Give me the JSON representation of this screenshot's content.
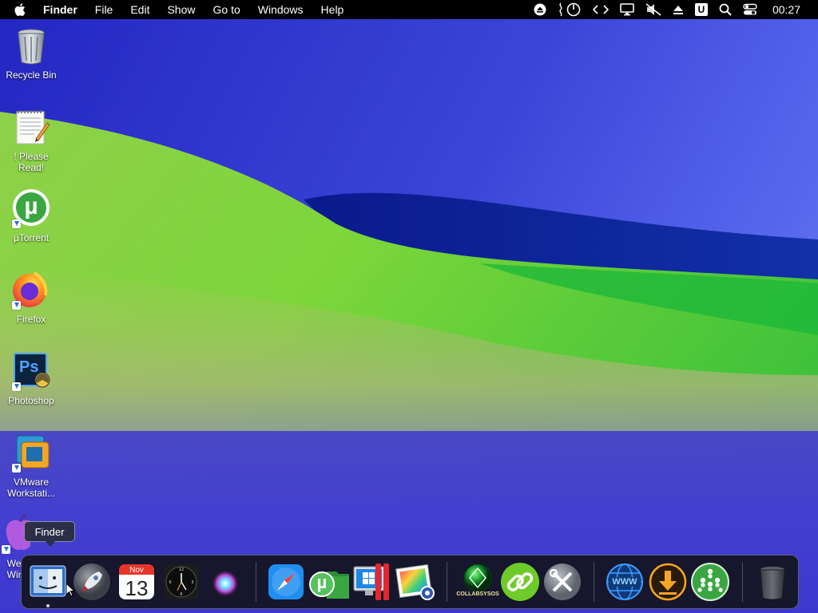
{
  "menubar": {
    "app_name": "Finder",
    "items": [
      "File",
      "Edit",
      "Show",
      "Go to",
      "Windows",
      "Help"
    ],
    "status_icons": [
      "eject-icon",
      "power-gauge-icon",
      "code-brackets-icon",
      "display-icon",
      "mute-icon",
      "up-triangle-icon",
      "u-badge-icon",
      "search-icon",
      "control-center-icon"
    ],
    "u_badge_label": "U",
    "clock": "00:27"
  },
  "desktop": {
    "icons": [
      {
        "label": "Recycle Bin"
      },
      {
        "label": "! Please Read!"
      },
      {
        "label": "μTorrent"
      },
      {
        "label": "Firefox"
      },
      {
        "label": "Photoshop"
      },
      {
        "label": "VMware Workstati..."
      },
      {
        "label": "Wel Win"
      }
    ]
  },
  "tooltip": {
    "label": "Finder"
  },
  "dock": {
    "calendar": {
      "month": "Nov",
      "day": "13"
    },
    "collabsysos_label": "COLLABSYSOS",
    "www_label": "WWW"
  },
  "icon_text": {
    "photoshop": "Ps",
    "utorrent": "µ"
  },
  "colors": {
    "menubar": "#000000",
    "wallpaper_blue": "#3a3fd0",
    "wallpaper_green": "#6fd23a",
    "accent": "#2a6fd6"
  }
}
